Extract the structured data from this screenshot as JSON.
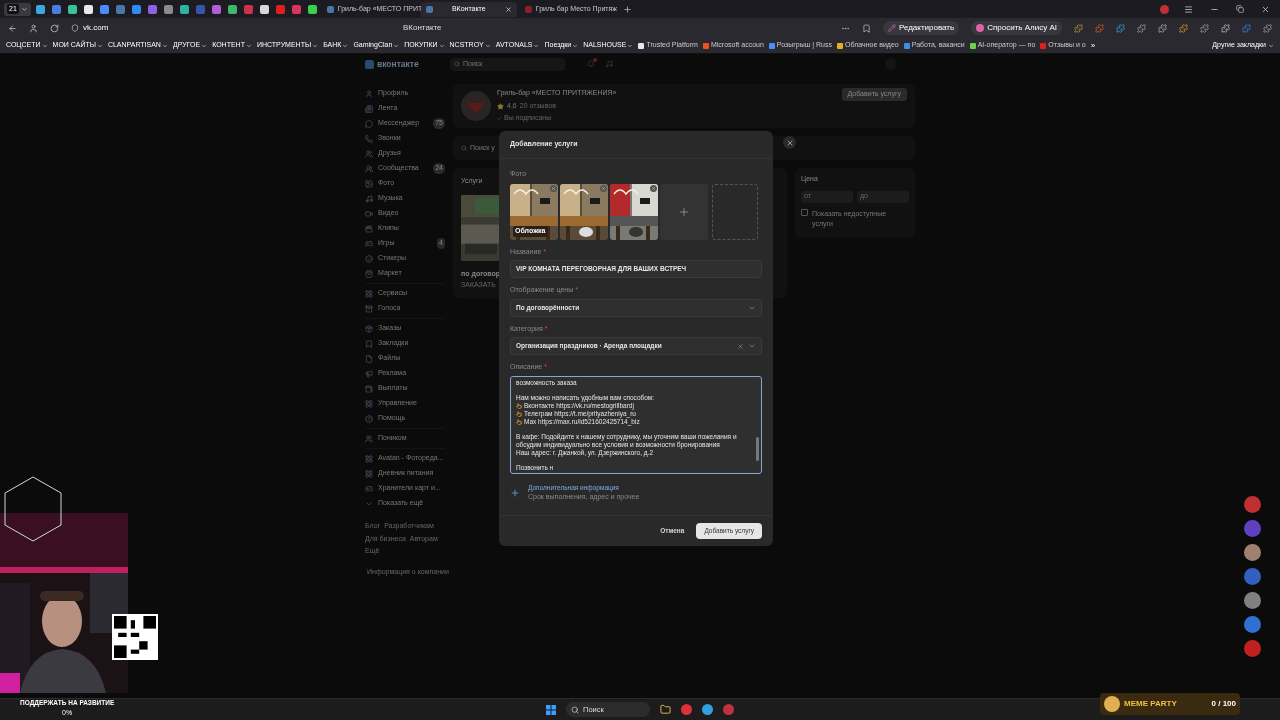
{
  "browser": {
    "tab_count": "21",
    "pinned_tabs": [
      {
        "color": "#39a7e0"
      },
      {
        "color": "#4a7de0"
      },
      {
        "color": "#37c2a0"
      },
      {
        "color": "#e8e8e8"
      },
      {
        "color": "#4a8cff"
      },
      {
        "color": "#4a76a8"
      },
      {
        "color": "#2d8cf0"
      },
      {
        "color": "#8a63e0"
      },
      {
        "color": "#8a8a8a"
      },
      {
        "color": "#2bb5a0"
      },
      {
        "color": "#3355aa"
      },
      {
        "color": "#b15dd6"
      },
      {
        "color": "#3bb86b"
      },
      {
        "color": "#d0304a"
      },
      {
        "color": "#d8d8d8"
      },
      {
        "color": "#e02020"
      },
      {
        "color": "#d8345f"
      },
      {
        "color": "#3ccf4e"
      }
    ],
    "tabs": [
      {
        "title": "Гриль-бар «МЕСТО ПРИТ",
        "selected": false,
        "color": "#4a76a8"
      },
      {
        "title": "ВКонтакте",
        "selected": true,
        "color": "#4a76a8"
      },
      {
        "title": "Гриль бар Место Притяж",
        "selected": false,
        "color": "#8a1f2a"
      }
    ],
    "address": "vk.com",
    "page_title": "ВКонтакте",
    "actions": [
      "Редактировать",
      "Спросить Алису AI"
    ],
    "bookmark_folders": [
      "СОЦСЕТИ",
      "МОИ САЙТЫ",
      "CLANPARTISAN",
      "ДРУГОЕ",
      "КОНТЕНТ",
      "ИНСТРУМЕНТЫ",
      "БАНК",
      "GamingClan",
      "ПОКУПКИ",
      "NCSTROY",
      "AVTONALS",
      "Поездки",
      "NALSHOUSE"
    ],
    "bookmarks": [
      {
        "title": "Trusted Platform",
        "color": "#e8e8e8"
      },
      {
        "title": "Microsoft accoun",
        "color": "#f25022"
      },
      {
        "title": "Розыгрыш | Russ",
        "color": "#4a8cff"
      },
      {
        "title": "Облачное видео",
        "color": "#e0b020"
      },
      {
        "title": "Работа, ваканси",
        "color": "#3a8ee6"
      },
      {
        "title": "AI-оператор — по",
        "color": "#6bd04a"
      },
      {
        "title": "Отзывы и о",
        "color": "#e02020"
      }
    ],
    "more": "»",
    "other_bookmarks": "Другие закладки"
  },
  "vk": {
    "logo": "вконтакте",
    "search_placeholder": "Поиск",
    "sidebar": [
      [
        {
          "label": "Профиль",
          "kind": "profile"
        },
        {
          "label": "Лента",
          "kind": "feed"
        },
        {
          "label": "Мессенджер",
          "kind": "chat",
          "count": "75"
        },
        {
          "label": "Звонки",
          "kind": "phone"
        },
        {
          "label": "Друзья",
          "kind": "friends"
        },
        {
          "label": "Сообщества",
          "kind": "groups",
          "count": "24"
        },
        {
          "label": "Фото"
        },
        {
          "label": "Музыка",
          "kind": "music"
        },
        {
          "label": "Видео",
          "kind": "video"
        },
        {
          "label": "Клипы",
          "kind": "clips"
        },
        {
          "label": "Игры",
          "kind": "games",
          "count": "4"
        },
        {
          "label": "Стикеры",
          "kind": "stickers"
        },
        {
          "label": "Маркет",
          "kind": "market"
        }
      ],
      [
        {
          "label": "Сервисы",
          "kind": "apps"
        },
        {
          "label": "Голоса",
          "kind": "votes"
        }
      ],
      [
        {
          "label": "Заказы",
          "kind": "orders"
        },
        {
          "label": "Закладки",
          "kind": "bookmarks"
        },
        {
          "label": "Файлы",
          "kind": "files"
        },
        {
          "label": "Реклама",
          "kind": "ads"
        },
        {
          "label": "Выплаты",
          "kind": "payouts"
        },
        {
          "label": "Управление",
          "kind": "apps"
        },
        {
          "label": "Помощь",
          "kind": "help"
        }
      ],
      [
        {
          "label": "Поником",
          "kind": "friends"
        }
      ],
      [
        {
          "label": "Avatan - Фоторeда...",
          "kind": "apps"
        },
        {
          "label": "Дневник питания",
          "kind": "apps"
        },
        {
          "label": "Хранители карт и...",
          "kind": "games"
        },
        {
          "label": "Показать ещё",
          "kind": "more"
        }
      ]
    ],
    "footer_links": [
      "Блог",
      "Разработчикам",
      "Для бизнеса",
      "Авторам",
      "Ещё"
    ],
    "company_info": "Информация о компании",
    "group": {
      "name": "Гриль-бар «МЕСТО ПРИТЯЖЕНИЯ»",
      "rating": "4,6",
      "reviews": "20 отзывов",
      "subscribed": "Вы подписаны",
      "add_button": "Добавить услугу"
    },
    "services_search": "Поиск у",
    "services_title": "Услуги",
    "service_price": "по договор",
    "service_action": "ЗАКАЗАТЬ",
    "filters": {
      "title": "Цена",
      "from": "от",
      "to": "до",
      "show_unavailable": {
        "label": "Показать недоступные услуги",
        "checked": false
      }
    }
  },
  "modal": {
    "title": "Добавление услуги",
    "photo_label": "Фото",
    "cover_label": "Обложка",
    "name": {
      "label": "Название",
      "mark": "*",
      "value": "VIP КОМНАТА ПЕРЕГОВОРНАЯ ДЛЯ ВАШИХ ВСТРЕЧ"
    },
    "price": {
      "label": "Отображение цены",
      "mark": "*",
      "value": "По договорённости"
    },
    "category": {
      "label": "Категория",
      "mark": "*",
      "value": "Организация праздников · Аренда площадки"
    },
    "description": {
      "label": "Описание",
      "mark": "*",
      "lines": [
        {
          "kind": "text",
          "text": "возможность заказа"
        },
        {
          "kind": "blank"
        },
        {
          "kind": "text",
          "text": "Нам можно написать удобным вам способом:"
        },
        {
          "kind": "bullet",
          "text": "Вконтакте https://vk.ru/mestogrillbardj"
        },
        {
          "kind": "bullet",
          "text": "Телеграм https://t.me/prityazheniya_ru"
        },
        {
          "kind": "bullet",
          "text": "Max https://max.ru/id521602425714_biz"
        },
        {
          "kind": "blank"
        },
        {
          "kind": "text",
          "text": "В кафе: Подойдите к нашему сотруднику, мы уточним ваши пожелания и обсудим индивидуально все условия и возможности бронирования"
        },
        {
          "kind": "text",
          "text": "Наш адрес: г. Джанкой, ул. Дзержинского, д.2"
        },
        {
          "kind": "blank"
        },
        {
          "kind": "text",
          "text": "Позвонить н"
        }
      ]
    },
    "extra": {
      "title": "Дополнительная информация",
      "subtitle": "Срок выполнения, адрес и прочее"
    },
    "cancel": "Отмена",
    "submit": "Добавить услугу"
  },
  "overlay": {
    "support_label": "ПОДДЕРЖАТЬ НА РАЗВИТИЕ",
    "support_value": "0%",
    "meme_title": "MEME PARTY",
    "meme_count": "0 / 100"
  },
  "taskbar": {
    "search_placeholder": "Поиск"
  }
}
